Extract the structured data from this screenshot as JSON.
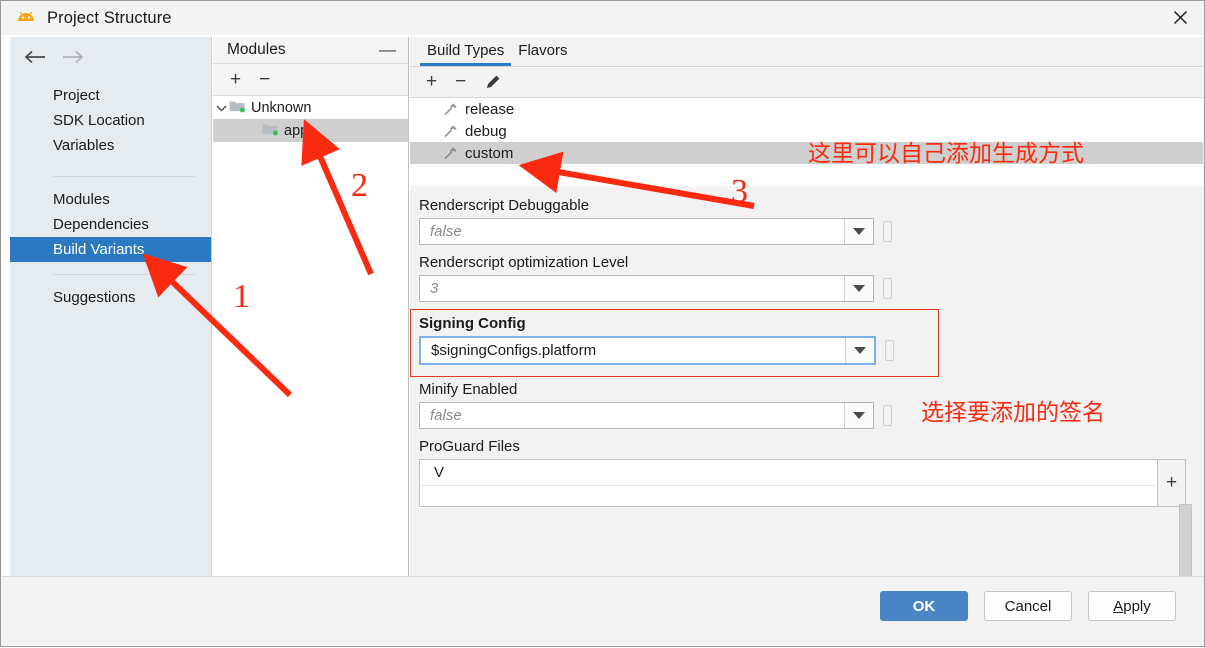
{
  "window": {
    "title": "Project Structure",
    "icon": "android-icon",
    "close": "close-icon"
  },
  "left_nav": {
    "back": "back-arrow-icon",
    "forward": "forward-arrow-icon",
    "group1": [
      {
        "label": "Project",
        "selected": false
      },
      {
        "label": "SDK Location",
        "selected": false
      },
      {
        "label": "Variables",
        "selected": false
      }
    ],
    "group2": [
      {
        "label": "Modules",
        "selected": false
      },
      {
        "label": "Dependencies",
        "selected": false
      },
      {
        "label": "Build Variants",
        "selected": true
      }
    ],
    "group3": [
      {
        "label": "Suggestions",
        "selected": false
      }
    ]
  },
  "modules": {
    "header_title": "Modules",
    "minimize": "—",
    "tools": {
      "add": "+",
      "remove": "−"
    },
    "tree": [
      {
        "label": "Unknown",
        "level": 0,
        "expanded": true,
        "selected": false
      },
      {
        "label": "app",
        "level": 1,
        "expanded": false,
        "selected": true
      }
    ]
  },
  "right_pane": {
    "tabs": [
      {
        "label": "Build Types",
        "active": true
      },
      {
        "label": "Flavors",
        "active": false
      }
    ],
    "toolbar": {
      "add": "+",
      "remove": "−",
      "edit": "pencil-icon"
    },
    "build_types": [
      {
        "label": "release",
        "selected": false
      },
      {
        "label": "debug",
        "selected": false
      },
      {
        "label": "custom",
        "selected": true
      }
    ],
    "fields": [
      {
        "label": "Renderscript Debuggable",
        "value": "false",
        "placeholder": true,
        "focused": false,
        "bold": false
      },
      {
        "label": "Renderscript optimization Level",
        "value": "3",
        "placeholder": true,
        "focused": false,
        "bold": false
      },
      {
        "label": "Signing Config",
        "value": "$signingConfigs.platform",
        "placeholder": false,
        "focused": true,
        "bold": true
      },
      {
        "label": "Minify Enabled",
        "value": "false",
        "placeholder": true,
        "focused": false,
        "bold": false
      }
    ],
    "proguard": {
      "label": "ProGuard Files",
      "items": [
        "V"
      ],
      "add_button": "+"
    }
  },
  "footer": {
    "ok": "OK",
    "cancel": "Cancel",
    "apply_prefix": "A",
    "apply_rest": "pply"
  },
  "annotations": {
    "note_build_types": "这里可以自己添加生成方式",
    "note_signing": "选择要添加的签名",
    "marker_1": "1",
    "marker_2": "2",
    "marker_3": "3",
    "color": "#fa2a10"
  }
}
